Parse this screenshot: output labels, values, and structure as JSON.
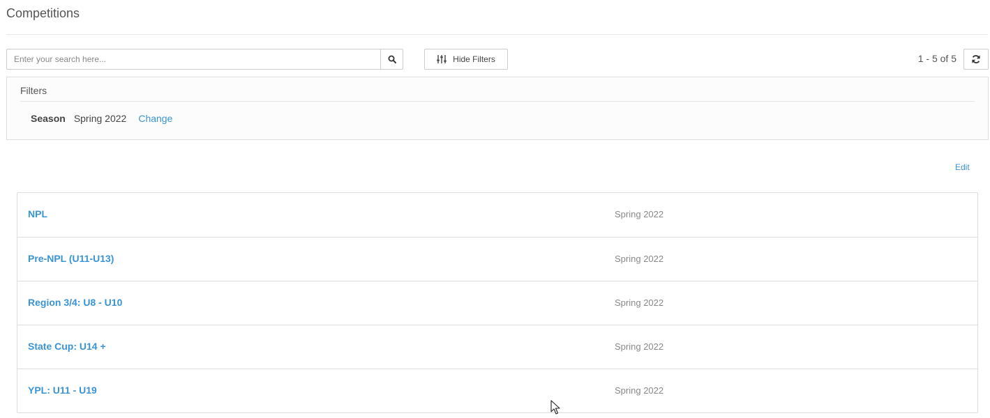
{
  "page": {
    "title": "Competitions"
  },
  "search": {
    "placeholder": "Enter your search here...",
    "value": "",
    "button_icon": "search-icon"
  },
  "toolbar": {
    "hide_filters_label": "Hide Filters",
    "hide_filters_icon": "sliders-icon",
    "pager_text": "1 - 5 of 5",
    "refresh_icon": "refresh-icon"
  },
  "filters": {
    "heading": "Filters",
    "items": [
      {
        "key": "Season",
        "value": "Spring 2022",
        "action": "Change"
      }
    ]
  },
  "list_actions": {
    "edit_label": "Edit"
  },
  "competitions": [
    {
      "name": "NPL",
      "season": "Spring 2022"
    },
    {
      "name": "Pre-NPL (U11-U13)",
      "season": "Spring 2022"
    },
    {
      "name": "Region 3/4: U8 - U10",
      "season": "Spring 2022"
    },
    {
      "name": "State Cup: U14 +",
      "season": "Spring 2022"
    },
    {
      "name": "YPL: U11 - U19",
      "season": "Spring 2022"
    }
  ],
  "colors": {
    "link": "#3a93d4",
    "muted": "#888888",
    "border": "#dddddd"
  }
}
